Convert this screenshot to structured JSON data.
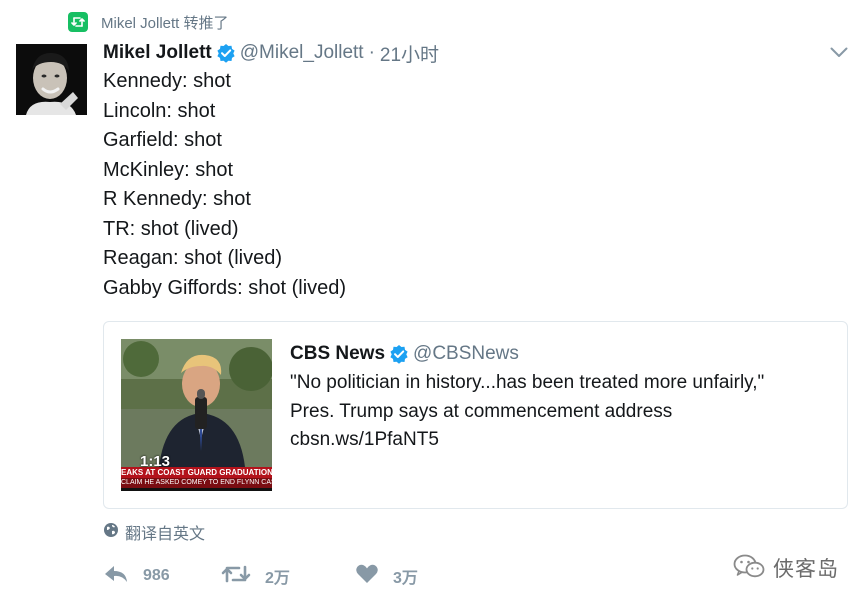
{
  "retweet_context": {
    "icon": "retweet-icon",
    "text": "Mikel Jollett 转推了",
    "accent_color": "#17bf63"
  },
  "tweet": {
    "author_name": "Mikel Jollett",
    "verified": true,
    "handle": "@Mikel_Jollett",
    "separator": "·",
    "time": "21小时",
    "lines": [
      "Kennedy: shot",
      "Lincoln: shot",
      "Garfield: shot",
      "McKinley: shot",
      "R Kennedy: shot",
      "TR: shot (lived)",
      "Reagan: shot (lived)",
      "Gabby Giffords: shot (lived)"
    ]
  },
  "quoted": {
    "author_name": "CBS News",
    "verified": true,
    "handle": "@CBSNews",
    "lines": [
      "\"No politician in history...has been treated more unfairly,\"",
      "Pres. Trump says at commencement address",
      "cbsn.ws/1PfaNT5"
    ],
    "video": {
      "duration": "1:13",
      "ticker_top": "EAKS AT COAST GUARD GRADUATION",
      "ticker_bottom": "CLAIM HE ASKED COMEY TO END FLYNN CASE"
    }
  },
  "translate": {
    "icon": "globe-icon",
    "label": "翻译自英文"
  },
  "actions": {
    "reply": {
      "icon": "reply-icon",
      "count": "986"
    },
    "retweet": {
      "icon": "retweet-icon",
      "count": "2万"
    },
    "like": {
      "icon": "heart-icon",
      "count": "3万"
    }
  },
  "watermark": {
    "icon": "wechat-icon",
    "text": "侠客岛"
  },
  "colors": {
    "text": "#14171a",
    "secondary": "#657786",
    "verified_blue": "#1da1f2",
    "action_gray": "#8899a6",
    "border": "#e1e8ed"
  }
}
